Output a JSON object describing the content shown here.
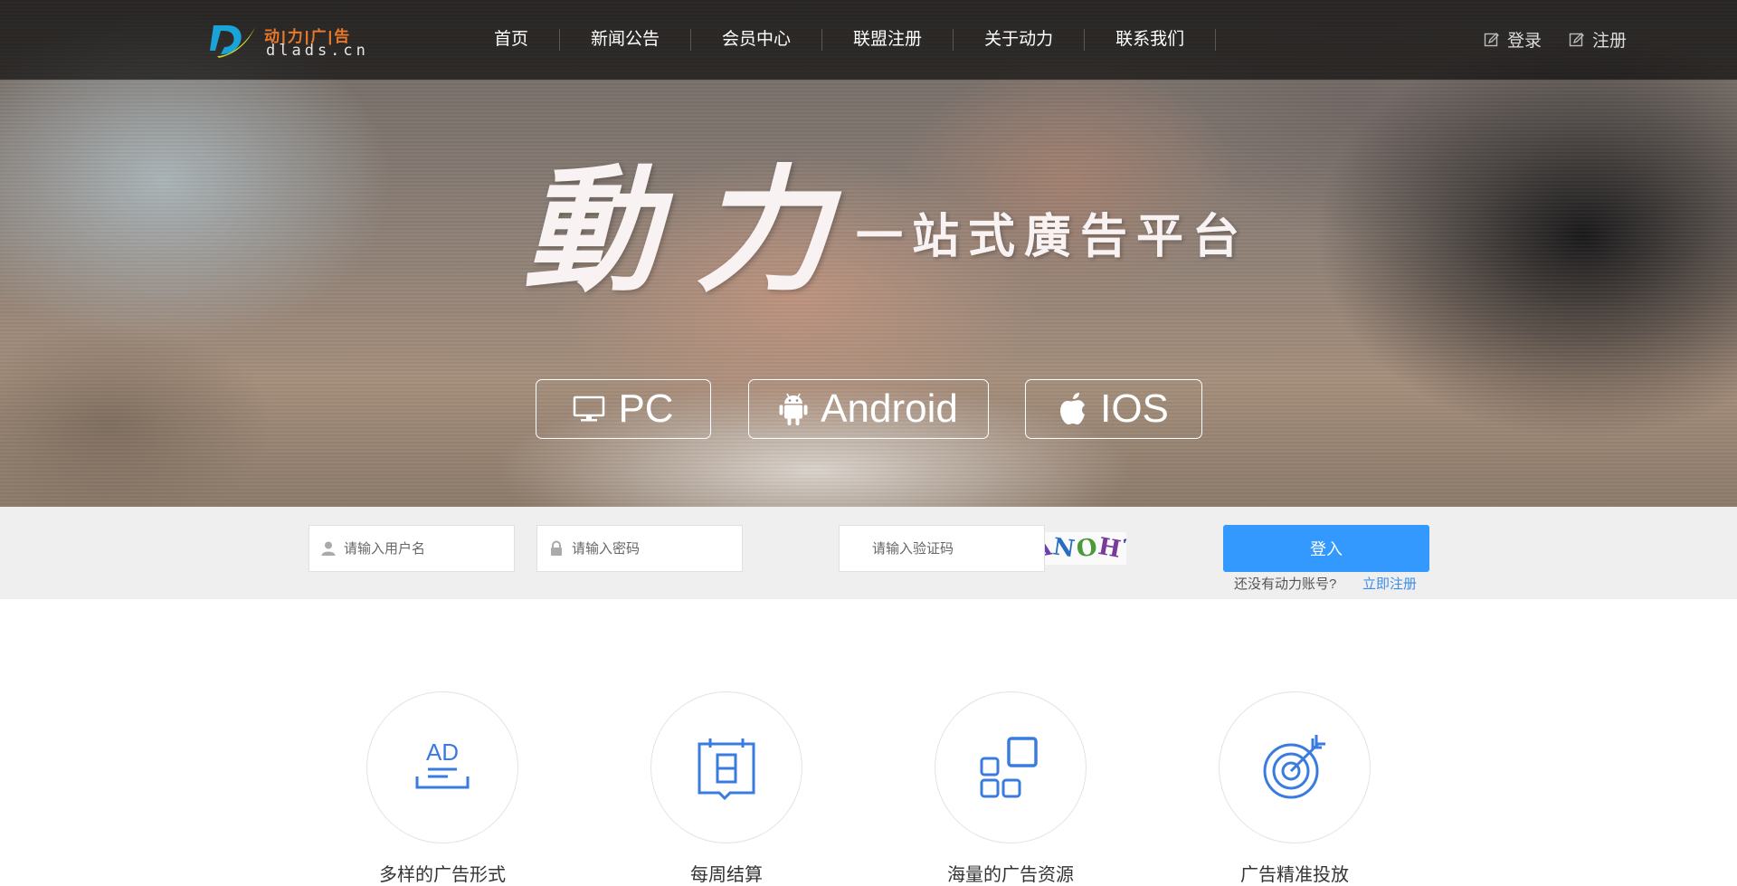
{
  "brand": {
    "logo_cn": "动|力|广|告",
    "logo_en": "dlads.cn",
    "colors": {
      "orange": "#e8792b",
      "teal": "#1aa3d6",
      "yellow": "#c8d430"
    }
  },
  "nav": {
    "items": [
      {
        "label": "首页"
      },
      {
        "label": "新闻公告"
      },
      {
        "label": "会员中心"
      },
      {
        "label": "联盟注册"
      },
      {
        "label": "关于动力"
      },
      {
        "label": "联系我们"
      }
    ]
  },
  "auth": {
    "login": {
      "label": "登录",
      "icon": "edit-icon"
    },
    "register": {
      "label": "注册",
      "icon": "edit-icon"
    }
  },
  "hero": {
    "big_char_1": "動",
    "big_char_2": "力",
    "subtitle": "一站式廣告平台",
    "platforms": [
      {
        "label": "PC",
        "icon": "monitor-icon"
      },
      {
        "label": "Android",
        "icon": "android-icon"
      },
      {
        "label": "IOS",
        "icon": "apple-icon"
      }
    ]
  },
  "login_form": {
    "username_placeholder": "请输入用户名",
    "password_placeholder": "请输入密码",
    "captcha_placeholder": "请输入验证码",
    "captcha_text": [
      "A",
      "N",
      "O",
      "H",
      "?"
    ],
    "submit_label": "登入",
    "no_account_text": "还没有动力账号?",
    "register_link": "立即注册",
    "accent_color": "#3399ff"
  },
  "features": [
    {
      "label": "多样的广告形式",
      "icon": "ad-icon"
    },
    {
      "label": "每周结算",
      "icon": "calendar-icon"
    },
    {
      "label": "海量的广告资源",
      "icon": "grid-apps-icon"
    },
    {
      "label": "广告精准投放",
      "icon": "target-icon"
    }
  ],
  "icon_color": "#3a7be0"
}
